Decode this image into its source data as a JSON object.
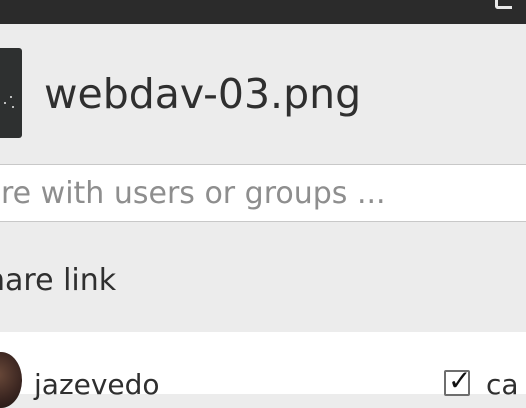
{
  "file": {
    "name": "webdav-03.png"
  },
  "share": {
    "placeholder": "re with users or groups ..."
  },
  "link": {
    "label": "hare link"
  },
  "user": {
    "name": "jazevedo",
    "can_share_label": "ca",
    "can_share_checked": "✓"
  },
  "icons": {
    "titlebar": "dropdown-icon",
    "thumbnail": "image-thumbnail",
    "avatar": "user-avatar"
  },
  "colors": {
    "titlebar": "#2b2b2b",
    "panel": "#ececec",
    "input": "#ffffff"
  }
}
